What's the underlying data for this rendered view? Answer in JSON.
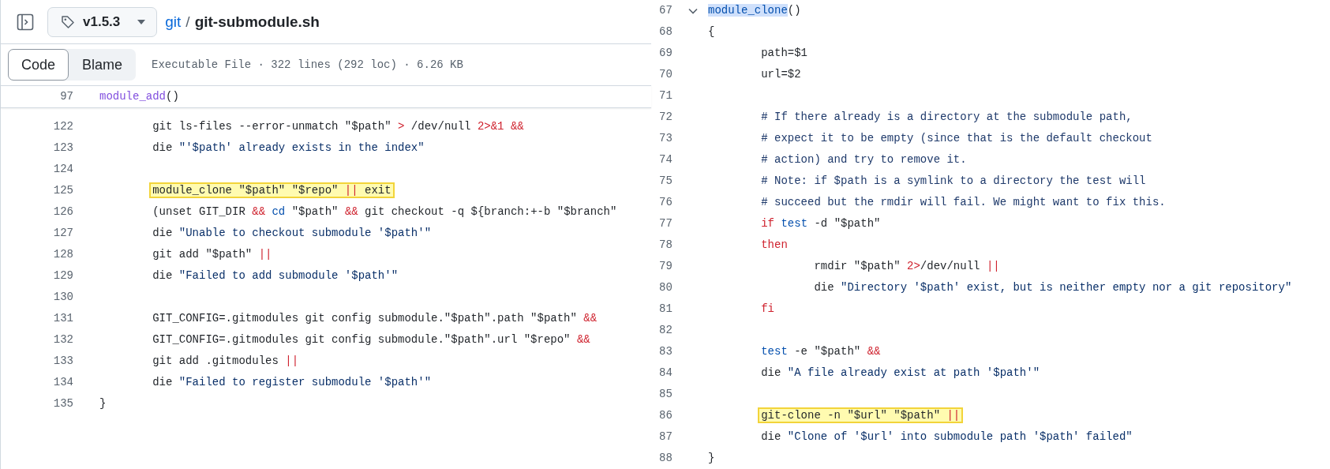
{
  "header": {
    "version": "v1.5.3",
    "breadcrumb": {
      "repo": "git",
      "separator": "/",
      "file": "git-submodule.sh"
    }
  },
  "toolbar": {
    "tabs": [
      {
        "label": "Code",
        "selected": true
      },
      {
        "label": "Blame",
        "selected": false
      }
    ],
    "file_info": "Executable File · 322 lines (292 loc) · 6.26 KB"
  },
  "sticky_line": {
    "number": "97",
    "kind": "top",
    "tokens": [
      {
        "text": "module_add",
        "kind": "func"
      },
      {
        "text": "()",
        "kind": "plain"
      }
    ]
  },
  "left_code": [
    {
      "number": "122",
      "kind": "body",
      "highlighted": false,
      "tokens": [
        {
          "text": "git ls-files --error-unmatch \"$path\" ",
          "kind": "plain"
        },
        {
          "text": ">",
          "kind": "keyword"
        },
        {
          "text": " /dev/null ",
          "kind": "plain"
        },
        {
          "text": "2>&1 &&",
          "kind": "keyword"
        }
      ]
    },
    {
      "number": "123",
      "kind": "body",
      "highlighted": false,
      "tokens": [
        {
          "text": "die ",
          "kind": "plain"
        },
        {
          "text": "\"'$path' already exists in the index\"",
          "kind": "string"
        }
      ]
    },
    {
      "number": "124",
      "kind": "blank"
    },
    {
      "number": "125",
      "kind": "body",
      "highlighted": true,
      "tokens": [
        {
          "text": "module_clone \"$path\" \"$repo\" ",
          "kind": "plain"
        },
        {
          "text": "||",
          "kind": "keyword"
        },
        {
          "text": " exit",
          "kind": "plain"
        }
      ]
    },
    {
      "number": "126",
      "kind": "body",
      "highlighted": false,
      "tokens": [
        {
          "text": "(unset GIT_DIR ",
          "kind": "plain"
        },
        {
          "text": "&& ",
          "kind": "keyword"
        },
        {
          "text": "cd",
          "kind": "builtin"
        },
        {
          "text": " \"$path\" ",
          "kind": "plain"
        },
        {
          "text": "&&",
          "kind": "keyword"
        },
        {
          "text": " git checkout -q ${branch:+-b \"$branch\"",
          "kind": "plain"
        }
      ]
    },
    {
      "number": "127",
      "kind": "body",
      "highlighted": false,
      "tokens": [
        {
          "text": "die ",
          "kind": "plain"
        },
        {
          "text": "\"Unable to checkout submodule '$path'\"",
          "kind": "string"
        }
      ]
    },
    {
      "number": "128",
      "kind": "body",
      "highlighted": false,
      "tokens": [
        {
          "text": "git add \"$path\" ",
          "kind": "plain"
        },
        {
          "text": "||",
          "kind": "keyword"
        }
      ]
    },
    {
      "number": "129",
      "kind": "body",
      "highlighted": false,
      "tokens": [
        {
          "text": "die ",
          "kind": "plain"
        },
        {
          "text": "\"Failed to add submodule '$path'\"",
          "kind": "string"
        }
      ]
    },
    {
      "number": "130",
      "kind": "blank"
    },
    {
      "number": "131",
      "kind": "body",
      "highlighted": false,
      "tokens": [
        {
          "text": "GIT_CONFIG=.gitmodules git config submodule.\"$path\".path \"$path\" ",
          "kind": "plain"
        },
        {
          "text": "&&",
          "kind": "keyword"
        }
      ]
    },
    {
      "number": "132",
      "kind": "body",
      "highlighted": false,
      "tokens": [
        {
          "text": "GIT_CONFIG=.gitmodules git config submodule.\"$path\".url \"$repo\" ",
          "kind": "plain"
        },
        {
          "text": "&&",
          "kind": "keyword"
        }
      ]
    },
    {
      "number": "133",
      "kind": "body",
      "highlighted": false,
      "tokens": [
        {
          "text": "git add .gitmodules ",
          "kind": "plain"
        },
        {
          "text": "||",
          "kind": "keyword"
        }
      ]
    },
    {
      "number": "134",
      "kind": "body",
      "highlighted": false,
      "tokens": [
        {
          "text": "die ",
          "kind": "plain"
        },
        {
          "text": "\"Failed to register submodule '$path'\"",
          "kind": "string"
        }
      ]
    },
    {
      "number": "135",
      "kind": "top",
      "highlighted": false,
      "tokens": [
        {
          "text": "}",
          "kind": "plain"
        }
      ]
    }
  ],
  "right_code": [
    {
      "number": "67",
      "kind": "top",
      "highlighted": false,
      "expanded": true,
      "tokens": [
        {
          "text": "module_clone",
          "kind": "selection"
        },
        {
          "text": "()",
          "kind": "plain"
        }
      ]
    },
    {
      "number": "68",
      "kind": "top",
      "highlighted": false,
      "tokens": [
        {
          "text": "{",
          "kind": "plain"
        }
      ]
    },
    {
      "number": "69",
      "kind": "body",
      "highlighted": false,
      "tokens": [
        {
          "text": "path=$1",
          "kind": "plain"
        }
      ]
    },
    {
      "number": "70",
      "kind": "body",
      "highlighted": false,
      "tokens": [
        {
          "text": "url=$2",
          "kind": "plain"
        }
      ]
    },
    {
      "number": "71",
      "kind": "blank"
    },
    {
      "number": "72",
      "kind": "body",
      "highlighted": false,
      "tokens": [
        {
          "text": "# If there already is a directory at the submodule path,",
          "kind": "comment"
        }
      ]
    },
    {
      "number": "73",
      "kind": "body",
      "highlighted": false,
      "tokens": [
        {
          "text": "# expect it to be empty (since that is the default checkout",
          "kind": "comment"
        }
      ]
    },
    {
      "number": "74",
      "kind": "body",
      "highlighted": false,
      "tokens": [
        {
          "text": "# action) and try to remove it.",
          "kind": "comment"
        }
      ]
    },
    {
      "number": "75",
      "kind": "body",
      "highlighted": false,
      "tokens": [
        {
          "text": "# Note: if $path is a symlink to a directory the test will",
          "kind": "comment"
        }
      ]
    },
    {
      "number": "76",
      "kind": "body",
      "highlighted": false,
      "tokens": [
        {
          "text": "# succeed but the rmdir will fail. We might want to fix this.",
          "kind": "comment"
        }
      ]
    },
    {
      "number": "77",
      "kind": "body",
      "highlighted": false,
      "tokens": [
        {
          "text": "if ",
          "kind": "keyword"
        },
        {
          "text": "test",
          "kind": "builtin"
        },
        {
          "text": " -d \"$path\"",
          "kind": "plain"
        }
      ]
    },
    {
      "number": "78",
      "kind": "body",
      "highlighted": false,
      "tokens": [
        {
          "text": "then",
          "kind": "keyword"
        }
      ]
    },
    {
      "number": "79",
      "kind": "nested",
      "highlighted": false,
      "tokens": [
        {
          "text": "rmdir \"$path\" ",
          "kind": "plain"
        },
        {
          "text": "2>",
          "kind": "keyword"
        },
        {
          "text": "/dev/null ",
          "kind": "plain"
        },
        {
          "text": "||",
          "kind": "keyword"
        }
      ]
    },
    {
      "number": "80",
      "kind": "nested",
      "highlighted": false,
      "tokens": [
        {
          "text": "die ",
          "kind": "plain"
        },
        {
          "text": "\"Directory '$path' exist, but is neither empty nor a git repository\"",
          "kind": "string"
        }
      ]
    },
    {
      "number": "81",
      "kind": "body",
      "highlighted": false,
      "tokens": [
        {
          "text": "fi",
          "kind": "keyword"
        }
      ]
    },
    {
      "number": "82",
      "kind": "blank"
    },
    {
      "number": "83",
      "kind": "body",
      "highlighted": false,
      "tokens": [
        {
          "text": "test",
          "kind": "builtin"
        },
        {
          "text": " -e \"$path\" ",
          "kind": "plain"
        },
        {
          "text": "&&",
          "kind": "keyword"
        }
      ]
    },
    {
      "number": "84",
      "kind": "body",
      "highlighted": false,
      "tokens": [
        {
          "text": "die ",
          "kind": "plain"
        },
        {
          "text": "\"A file already exist at path '$path'\"",
          "kind": "string"
        }
      ]
    },
    {
      "number": "85",
      "kind": "blank"
    },
    {
      "number": "86",
      "kind": "body",
      "highlighted": true,
      "tokens": [
        {
          "text": "git-clone -n \"$url\" \"$path\" ",
          "kind": "plain"
        },
        {
          "text": "||",
          "kind": "keyword"
        }
      ]
    },
    {
      "number": "87",
      "kind": "body",
      "highlighted": false,
      "tokens": [
        {
          "text": "die ",
          "kind": "plain"
        },
        {
          "text": "\"Clone of '$url' into submodule path '$path' failed\"",
          "kind": "string"
        }
      ]
    },
    {
      "number": "88",
      "kind": "top",
      "highlighted": false,
      "tokens": [
        {
          "text": "}",
          "kind": "plain"
        }
      ]
    }
  ]
}
